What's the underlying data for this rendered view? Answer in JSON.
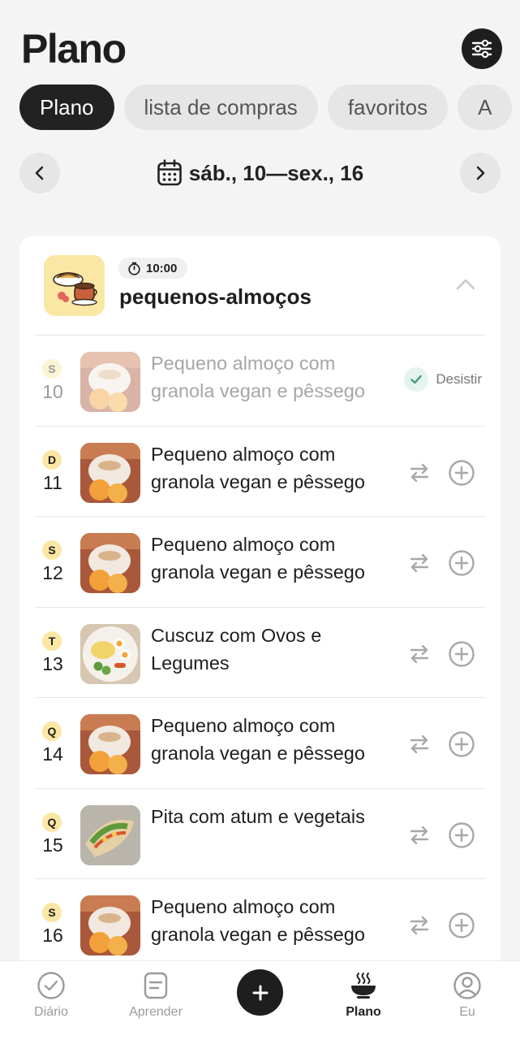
{
  "header": {
    "title": "Plano"
  },
  "tabs": [
    {
      "label": "Plano",
      "active": true
    },
    {
      "label": "lista de compras",
      "active": false
    },
    {
      "label": "favoritos",
      "active": false
    },
    {
      "label": "A",
      "active": false
    }
  ],
  "week": {
    "label": "sáb., 10—sex., 16"
  },
  "meal": {
    "name": "pequenos-almoços",
    "time": "10:00"
  },
  "rows": [
    {
      "letter": "S",
      "day": "10",
      "recipe": "Pequeno almoço com granola vegan e pêssego",
      "status": "Desistir",
      "done": true
    },
    {
      "letter": "D",
      "day": "11",
      "recipe": "Pequeno almoço com granola vegan e pêssego",
      "done": false
    },
    {
      "letter": "S",
      "day": "12",
      "recipe": "Pequeno almoço com granola vegan e pêssego",
      "done": false
    },
    {
      "letter": "T",
      "day": "13",
      "recipe": "Cuscuz com Ovos e Legumes",
      "done": false
    },
    {
      "letter": "Q",
      "day": "14",
      "recipe": "Pequeno almoço com granola vegan e pêssego",
      "done": false
    },
    {
      "letter": "Q",
      "day": "15",
      "recipe": "Pita com atum e vegetais",
      "done": false
    },
    {
      "letter": "S",
      "day": "16",
      "recipe": "Pequeno almoço com granola vegan e pêssego",
      "done": false
    }
  ],
  "bottom_nav": [
    {
      "label": "Diário",
      "icon": "check-circle-icon",
      "active": false
    },
    {
      "label": "Aprender",
      "icon": "document-icon",
      "active": false
    },
    {
      "label": "Plano",
      "icon": "bowl-icon",
      "active": true
    },
    {
      "label": "Eu",
      "icon": "profile-icon",
      "active": false
    }
  ],
  "colors": {
    "dark": "#1e1e1e",
    "accent_yellow": "#fbe7a4",
    "check_green": "#3f9b83",
    "background": "#f4f4f4"
  }
}
